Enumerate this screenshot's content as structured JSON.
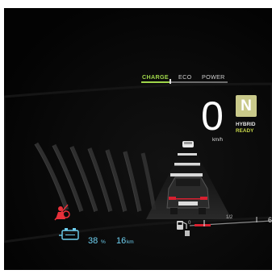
{
  "drive_mode": {
    "labels": [
      "CHARGE",
      "ECO",
      "POWER"
    ],
    "active": "CHARGE",
    "accent_color": "#9fd64a"
  },
  "gear": {
    "letter": "N",
    "status_line1": "HYBRID",
    "status_line2": "READY",
    "color": "#c9c98a"
  },
  "speed": {
    "value": "0",
    "unit": "km/h"
  },
  "ev_status": {
    "battery_percent": "38",
    "percent_unit": "%",
    "range": "16",
    "range_unit": "km",
    "color": "#6ecff0"
  },
  "fuel": {
    "half_mark": "1/2",
    "full_mark": "6",
    "icon": "fuel-pump-icon"
  },
  "warning": {
    "icon": "airbag-off-icon",
    "color": "#e8303a"
  },
  "icons": {
    "battery": "hybrid-battery-icon",
    "car": "rear-car-icon"
  }
}
